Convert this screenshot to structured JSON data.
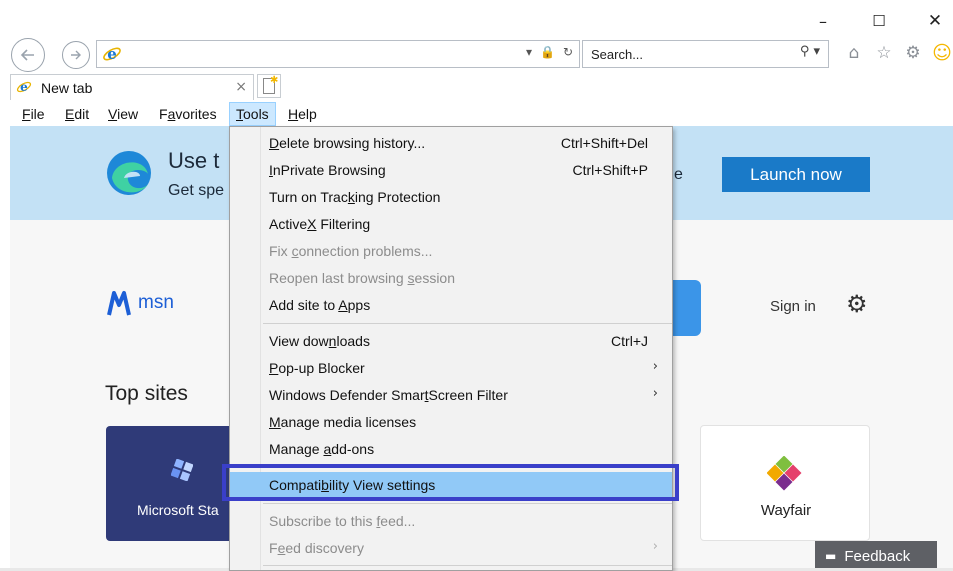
{
  "window": {
    "minimize_glyph": "–",
    "maximize_glyph": "☐",
    "close_glyph": "✕"
  },
  "nav": {
    "back_icon": "arrow-left-icon",
    "forward_icon": "arrow-right-icon",
    "address_value": "",
    "address_tools": [
      "▾",
      "🔒",
      "↻"
    ]
  },
  "search": {
    "placeholder": "Search...",
    "icons": "⚲ ▾"
  },
  "toolbar_icons": [
    "home-icon",
    "favorites-star-icon",
    "settings-gear-icon",
    "feedback-smiley-icon"
  ],
  "tab": {
    "title": "New tab",
    "close_glyph": "×"
  },
  "menu_bar": {
    "items": [
      {
        "label": "File",
        "ul": "F",
        "rest": "ile"
      },
      {
        "label": "Edit",
        "ul": "E",
        "rest": "dit"
      },
      {
        "label": "View",
        "ul": "V",
        "rest": "iew"
      },
      {
        "label": "Favorites",
        "pre": "F",
        "ul": "a",
        "rest": "vorites"
      },
      {
        "label": "Tools",
        "ul": "T",
        "rest": "ools"
      },
      {
        "label": "Help",
        "ul": "H",
        "rest": "elp"
      }
    ],
    "active": "Tools"
  },
  "page": {
    "promo_title": "Use t",
    "promo_subtitle": "Get spe",
    "promo_fragment": "e",
    "launch_button": "Launch now",
    "msn_text": "msn",
    "sign_in": "Sign in",
    "top_sites_heading": "Top sites",
    "tiles": [
      {
        "label": "Microsoft Sta"
      },
      {
        "label": "Wayfair"
      }
    ],
    "feedback_label": "Feedback"
  },
  "tools_menu": {
    "items": [
      {
        "pre": "",
        "ul": "D",
        "post": "elete browsing history...",
        "shortcut": "Ctrl+Shift+Del",
        "state": "normal"
      },
      {
        "pre": "",
        "ul": "I",
        "post": "nPrivate Browsing",
        "shortcut": "Ctrl+Shift+P",
        "state": "normal"
      },
      {
        "pre": "Turn on Trac",
        "ul": "k",
        "post": "ing Protection",
        "shortcut": "",
        "state": "normal"
      },
      {
        "pre": "ActiveX",
        "ul": "",
        "post": " Filtering",
        "ul_word": "X",
        "shortcut": "",
        "state": "normal"
      },
      {
        "pre": "Fix ",
        "ul": "c",
        "post": "onnection problems...",
        "shortcut": "",
        "state": "disabled"
      },
      {
        "pre": "Reopen last browsing ",
        "ul": "s",
        "post": "ession",
        "shortcut": "",
        "state": "disabled"
      },
      {
        "pre": "Add site to ",
        "ul": "A",
        "post": "pps",
        "shortcut": "",
        "state": "normal"
      },
      {
        "pre": "View dow",
        "ul": "n",
        "post": "loads",
        "shortcut": "Ctrl+J",
        "state": "normal"
      },
      {
        "pre": "",
        "ul": "P",
        "post": "op-up Blocker",
        "shortcut": "",
        "arrow": "›",
        "state": "normal"
      },
      {
        "pre": "Windows Defender Smar",
        "ul": "t",
        "post": "Screen Filter",
        "shortcut": "",
        "arrow": "›",
        "state": "normal"
      },
      {
        "pre": "",
        "ul": "M",
        "post": "anage media licenses",
        "shortcut": "",
        "state": "normal"
      },
      {
        "pre": "Manage ",
        "ul": "a",
        "post": "dd-ons",
        "shortcut": "",
        "state": "normal"
      },
      {
        "pre": "Compati",
        "ul": "b",
        "post": "ility View settings",
        "shortcut": "",
        "state": "highlight"
      },
      {
        "pre": "Subscribe to this ",
        "ul": "f",
        "post": "eed...",
        "shortcut": "",
        "state": "disabled"
      },
      {
        "pre": "F",
        "ul": "e",
        "post": "ed discovery",
        "shortcut": "",
        "arrow": "›",
        "state": "disabled"
      }
    ]
  }
}
